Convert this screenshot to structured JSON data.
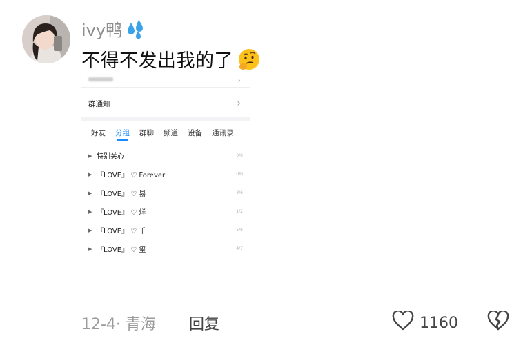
{
  "comment": {
    "username": "ivy鸭",
    "username_emoji": "sweat-droplets-icon",
    "text": "不得不发出我的了",
    "text_emoji": "thinking-face-icon"
  },
  "screenshot": {
    "notice_label": "群通知",
    "tabs": [
      "好友",
      "分组",
      "群聊",
      "频道",
      "设备",
      "通讯录"
    ],
    "active_tab": "分组",
    "accent_color": "#1a8cff",
    "groups": [
      {
        "name": "特别关心",
        "count": "0/0"
      },
      {
        "name": "『LOVE』 ♡ Forever",
        "count": "0/0"
      },
      {
        "name": "『LOVE』 ♡ 易",
        "count": "3/6"
      },
      {
        "name": "『LOVE』 ♡ 烊",
        "count": "1/2"
      },
      {
        "name": "『LOVE』 ♡ 千",
        "count": "5/6"
      },
      {
        "name": "『LOVE』 ♡ 玺",
        "count": "4/7"
      }
    ]
  },
  "footer": {
    "date_location": "12-4· 青海",
    "reply_label": "回复",
    "like_count": "1160"
  }
}
